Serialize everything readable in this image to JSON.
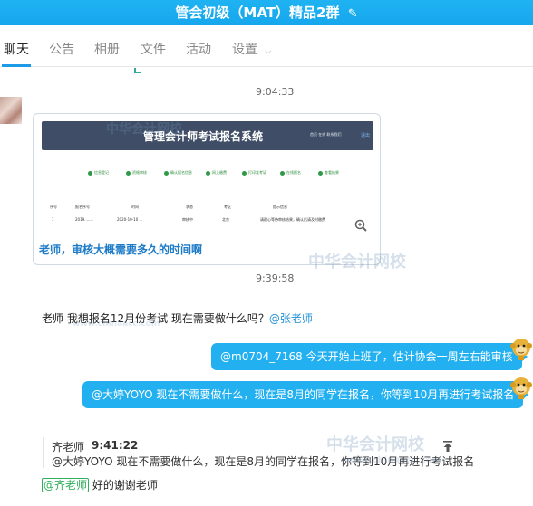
{
  "window": {
    "title": "管会初级（MAT）精品2群",
    "edit_icon": "pencil-icon"
  },
  "tabs": [
    {
      "label": "聊天",
      "active": true
    },
    {
      "label": "公告"
    },
    {
      "label": "相册"
    },
    {
      "label": "文件"
    },
    {
      "label": "活动"
    },
    {
      "label": "设置",
      "has_dropdown": true
    }
  ],
  "accent_color": "#23b0f0",
  "chat": {
    "top_cut_text": "...",
    "timestamps": [
      "9:04:33",
      "9:39:58"
    ],
    "image_message": {
      "screenshot_title": "管理会计师考试报名系统",
      "screenshot_top_links": "首页 在线 联系我们",
      "screenshot_top_right": "退出",
      "screenshot_steps": [
        "信息登记",
        "资格审核",
        "确认报名信息",
        "网上缴费",
        "打印准考证",
        "在线报名",
        "查看结果"
      ],
      "screenshot_table_head": [
        "序号",
        "报名序号",
        "时间",
        "状态",
        "考区",
        "提示信息"
      ],
      "screenshot_table_row": [
        "1",
        "2019........",
        "2020-10-10 ...",
        "审核中",
        "北京",
        "请耐心等待审核结果，确认后请及时缴费"
      ],
      "caption": "老师，审核大概需要多久的时间啊",
      "watermark": "中华会计网校"
    },
    "msg_student": {
      "text": "老师 我想报名12月份考试 现在需要做什么吗？",
      "mention": "@张老师"
    },
    "bubble1": "@m0704_7168 今天开始上班了，估计协会一周左右能审核",
    "bubble2": "@大婷YOYO 现在不需要做什么，现在是8月的同学在报名，你等到10月再进行考试报名",
    "reply": {
      "name": "齐老师",
      "time": "9:41:22",
      "text": "@大婷YOYO 现在不需要做什么，现在是8月的同学在报名，你等到10月再进行考试报名"
    },
    "last_msg": {
      "tag": "@齐老师",
      "text": " 好的谢谢老师"
    },
    "watermark_text": "中华会计网校",
    "watermark_url": "www.chinaacc.com"
  }
}
